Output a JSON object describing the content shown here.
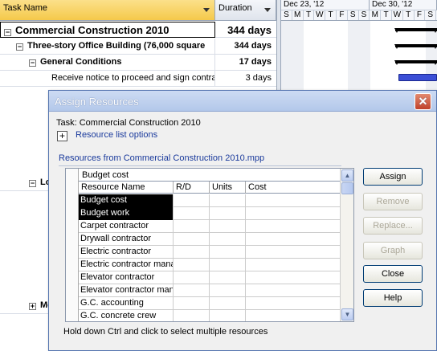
{
  "sheet": {
    "task_header": "Task Name",
    "duration_header": "Duration",
    "week1": "Dec 23, '12",
    "week2": "Dec 30, '12",
    "days": [
      "S",
      "M",
      "T",
      "W",
      "T",
      "F",
      "S",
      "S",
      "M",
      "T",
      "W",
      "T",
      "F",
      "S"
    ],
    "rows": [
      {
        "name": "Commercial Construction 2010",
        "dur": "344 days",
        "toggle": "−"
      },
      {
        "name": "Three-story Office Building (76,000 square",
        "dur": "344 days",
        "toggle": "−"
      },
      {
        "name": "General Conditions",
        "dur": "17 days",
        "toggle": "−"
      },
      {
        "name": "Receive notice to proceed and sign contra",
        "dur": "3 days"
      },
      {
        "name": "Lo",
        "toggle": "−"
      },
      {
        "name": "Mo",
        "toggle": "+"
      }
    ]
  },
  "dialog": {
    "title": "Assign Resources",
    "close_glyph": "✕",
    "task_line": "Task: Commercial Construction 2010",
    "plus_glyph": "+",
    "options_link": "Resource list options",
    "from_label": "Resources from Commercial Construction 2010.mpp",
    "edit_value": "Budget cost",
    "columns": [
      "Resource Name",
      "R/D",
      "Units",
      "Cost"
    ],
    "resources": [
      "Budget cost",
      "Budget work",
      "Carpet contractor",
      "Drywall contractor",
      "Electric contractor",
      "Electric contractor management",
      "Elevator contractor",
      "Elevator contractor management",
      "G.C. accounting",
      "G.C. concrete crew"
    ],
    "selected_count": 2,
    "buttons": {
      "assign": "Assign",
      "remove": "Remove",
      "replace": "Replace...",
      "graph": "Graph",
      "close": "Close",
      "help": "Help"
    },
    "hint": "Hold down Ctrl and click to select multiple resources"
  },
  "colors": {
    "header_accent": "#f5c94a",
    "task_bar": "#3b4fd6",
    "link": "#1a3a9c"
  }
}
